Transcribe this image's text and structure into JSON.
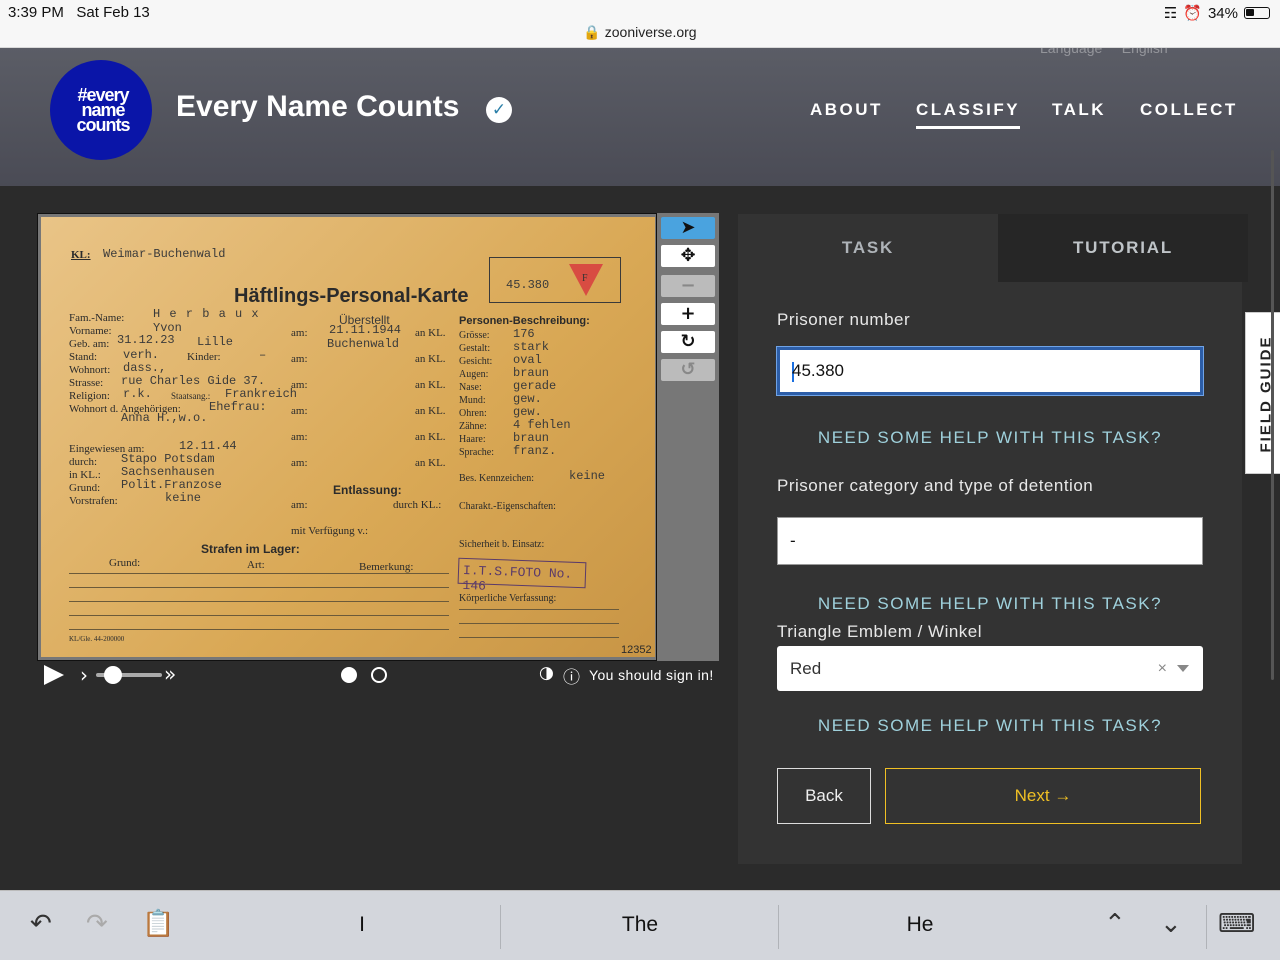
{
  "status_bar": {
    "time": "3:39 PM",
    "date": "Sat Feb 13",
    "battery": "34%",
    "url": "zooniverse.org"
  },
  "header": {
    "logo_text": "#every name counts",
    "title": "Every Name Counts",
    "nav": [
      {
        "label": "ABOUT",
        "active": false
      },
      {
        "label": "CLASSIFY",
        "active": true
      },
      {
        "label": "TALK",
        "active": false
      },
      {
        "label": "COLLECT",
        "active": false
      }
    ]
  },
  "card": {
    "camp": "Weimar-Buchenwald",
    "title": "Häftlings-Personal-Karte",
    "number": "45.380",
    "triangle_letter": "F",
    "fam_name": "H e r b a u x",
    "vorname": "Yvon",
    "geb_am": "31.12.23",
    "geb_in": "Lille",
    "stand": "verh.",
    "kinder": "–",
    "wohnort": "dass.,",
    "strasse": "rue Charles Gide 37.",
    "religion": "r.k.",
    "staatsang": "Frankreich",
    "angehoerige": "Ehefrau:",
    "angehoerige_name": "Anna H.,w.o.",
    "ueberstellt": "Überstellt",
    "ueberstellt_date": "21.11.1944",
    "ueberstellt_to": "Buchenwald",
    "eingewiesen": "12.11.44",
    "durch": "Stapo Potsdam",
    "in_kl": "Sachsenhausen",
    "grund": "Polit.Franzose",
    "vorstrafen": "keine",
    "entlassung": "Entlassung:",
    "strafen": "Strafen im Lager:",
    "beschreibung": "Personen-Beschreibung:",
    "groesse": "176",
    "gestalt": "stark",
    "gesicht": "oval",
    "augen": "braun",
    "nase": "gerade",
    "mund": "gew.",
    "ohren": "gew.",
    "zaehne": "4 fehlen",
    "haare": "braun",
    "sprache": "franz.",
    "kennzeichen": "keine",
    "stamp": "I.T.S.FOTO No. 146",
    "footer_code": "KL/Gle. 44-200000",
    "card_no": "12352"
  },
  "viewer": {
    "sign_in_text": "You should sign in!"
  },
  "panel": {
    "tab_task": "TASK",
    "tab_tutorial": "TUTORIAL",
    "q1_label": "Prisoner number",
    "q1_value": "45.380",
    "q2_label": "Prisoner category and type of detention",
    "q2_value": "-",
    "q3_label": "Triangle Emblem / Winkel",
    "q3_value": "Red",
    "help_text": "NEED SOME HELP WITH THIS TASK?",
    "back_label": "Back",
    "next_label": "Next →",
    "field_guide": "FIELD GUIDE"
  },
  "keyboard": {
    "suggestions": [
      "I",
      "The",
      "He"
    ]
  }
}
